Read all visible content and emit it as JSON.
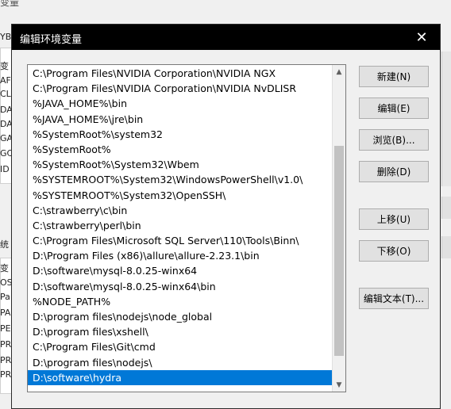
{
  "background": {
    "title": "变量",
    "left_fragments": [
      "YB",
      "变",
      "AF",
      "CL",
      "DA",
      "DA",
      "GA",
      "GC",
      "ID",
      "统",
      "变",
      "OS",
      "Pa",
      "PA",
      "PE",
      "PR",
      "PR",
      "PR"
    ]
  },
  "dialog": {
    "title": "编辑环境变量",
    "close_glyph": "✕"
  },
  "list": {
    "items": [
      "C:\\Program Files\\NVIDIA Corporation\\NVIDIA NGX",
      "C:\\Program Files\\NVIDIA Corporation\\NVIDIA NvDLISR",
      "%JAVA_HOME%\\bin",
      "%JAVA_HOME%\\jre\\bin",
      "%SystemRoot%\\system32",
      "%SystemRoot%",
      "%SystemRoot%\\System32\\Wbem",
      "%SYSTEMROOT%\\System32\\WindowsPowerShell\\v1.0\\",
      "%SYSTEMROOT%\\System32\\OpenSSH\\",
      "C:\\strawberry\\c\\bin",
      "C:\\strawberry\\perl\\bin",
      "C:\\Program Files\\Microsoft SQL Server\\110\\Tools\\Binn\\",
      "D:\\Program Files (x86)\\allure\\allure-2.23.1\\bin",
      "D:\\software\\mysql-8.0.25-winx64",
      "D:\\software\\mysql-8.0.25-winx64\\bin",
      "%NODE_PATH%",
      "D:\\program files\\nodejs\\node_global",
      "D:\\program files\\xshell\\",
      "C:\\Program Files\\Git\\cmd",
      "D:\\program files\\nodejs\\",
      "D:\\software\\hydra"
    ],
    "selected_index": 20,
    "scroll_position": 0.75
  },
  "buttons": {
    "new": "新建(N)",
    "edit": "编辑(E)",
    "browse": "浏览(B)...",
    "delete": "删除(D)",
    "move_up": "上移(U)",
    "move_down": "下移(O)",
    "edit_text": "编辑文本(T)..."
  },
  "colors": {
    "selection": "#0078d7",
    "titlebar": "#000000"
  }
}
